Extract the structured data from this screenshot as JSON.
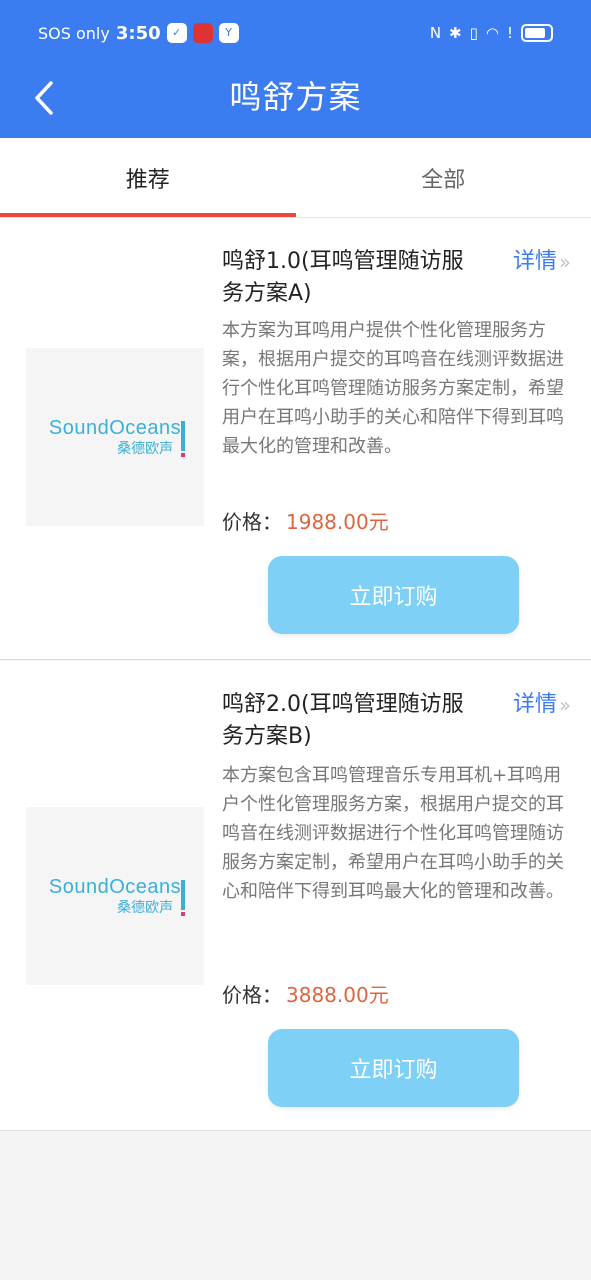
{
  "status_bar": {
    "carrier": "SOS only",
    "time": "3:50",
    "badge1": "✓",
    "badge2": "Y"
  },
  "header": {
    "title": "鸣舒方案"
  },
  "tabs": [
    {
      "label": "推荐",
      "active": true
    },
    {
      "label": "全部",
      "active": false
    }
  ],
  "logo": {
    "main_text": "SoundOceans",
    "sub_text": "桑德欧声"
  },
  "plans": [
    {
      "title": "鸣舒1.0(耳鸣管理随访服务方案A)",
      "detail_label": "详情",
      "description": "本方案为耳鸣用户提供个性化管理服务方案，根据用户提交的耳鸣音在线测评数据进行个性化耳鸣管理随访服务方案定制，希望用户在耳鸣小助手的关心和陪伴下得到耳鸣最大化的管理和改善。",
      "price_label": "价格：",
      "price": "1988.00元",
      "button_label": "立即订购"
    },
    {
      "title": "鸣舒2.0(耳鸣管理随访服务方案B)",
      "detail_label": "详情",
      "description": "本方案包含耳鸣管理音乐专用耳机+耳鸣用户个性化管理服务方案，根据用户提交的耳鸣音在线测评数据进行个性化耳鸣管理随访服务方案定制，希望用户在耳鸣小助手的关心和陪伴下得到耳鸣最大化的管理和改善。",
      "price_label": "价格：",
      "price": "3888.00元",
      "button_label": "立即订购"
    }
  ],
  "colors": {
    "primary": "#3b7cf0",
    "tab_indicator": "#e8483b",
    "price": "#e0643d",
    "button": "#7fd0f6"
  }
}
